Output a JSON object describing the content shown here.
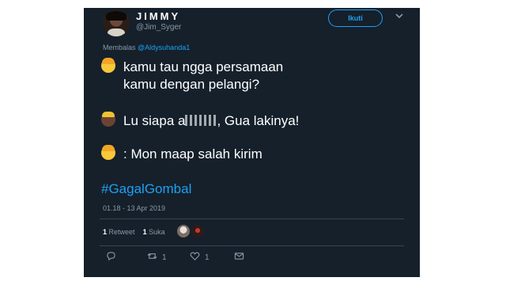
{
  "user": {
    "name": "JIMMY",
    "handle": "@Jim_Syger"
  },
  "follow_label": "Ikuti",
  "reply": {
    "prefix": "Membalas",
    "mention": "@Aldysuhanda1"
  },
  "tweet": {
    "line1": "kamu tau ngga persamaan",
    "line2": "kamu dengan pelangi?",
    "line3_a": "Lu siapa a",
    "line3_b": ", Gua lakinya!",
    "line4": ": Mon maap salah kirim",
    "hashtag": "#GagalGombal"
  },
  "timestamp": "01.18 - 13 Apr 2019",
  "stats": {
    "retweets": "1",
    "retweets_label": "Retweet",
    "likes": "1",
    "likes_label": "Suka"
  },
  "actions": {
    "retweet_count": "1",
    "like_count": "1"
  },
  "icons": [
    "reply-icon",
    "retweet-icon",
    "like-icon",
    "message-icon",
    "chevron-down-icon"
  ],
  "colors": {
    "background": "#15202b",
    "accent": "#1da1f2",
    "muted": "#8899a6"
  }
}
